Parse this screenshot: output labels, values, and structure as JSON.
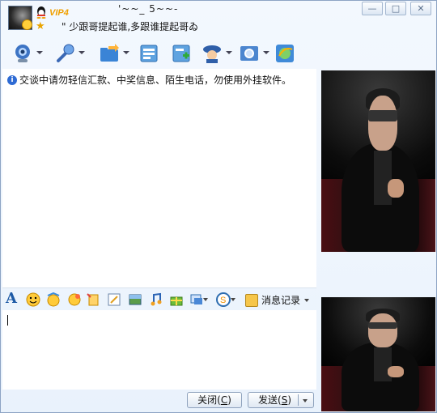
{
  "header": {
    "badge": "VIP4",
    "nickname_top": "'~~_ 5~~-",
    "signature": "\" 少跟哥提起谁,多跟谁提起哥ゐ"
  },
  "window_controls": {
    "min": "—",
    "max": "□",
    "close": "✕"
  },
  "toolbar": {
    "items": [
      "video-icon",
      "voice-icon",
      "file-transfer-icon",
      "message-icon",
      "add-app-icon",
      "remote-assist-icon",
      "settings-icon",
      "browser-icon"
    ]
  },
  "notice": {
    "text": "交谈中请勿轻信汇款、中奖信息、陌生电话，勿使用外挂软件。"
  },
  "format_bar": {
    "font_label": "A",
    "message_log": "消息记录"
  },
  "buttons": {
    "close_label": "关闭",
    "close_key": "C",
    "send_label": "发送",
    "send_key": "S"
  }
}
